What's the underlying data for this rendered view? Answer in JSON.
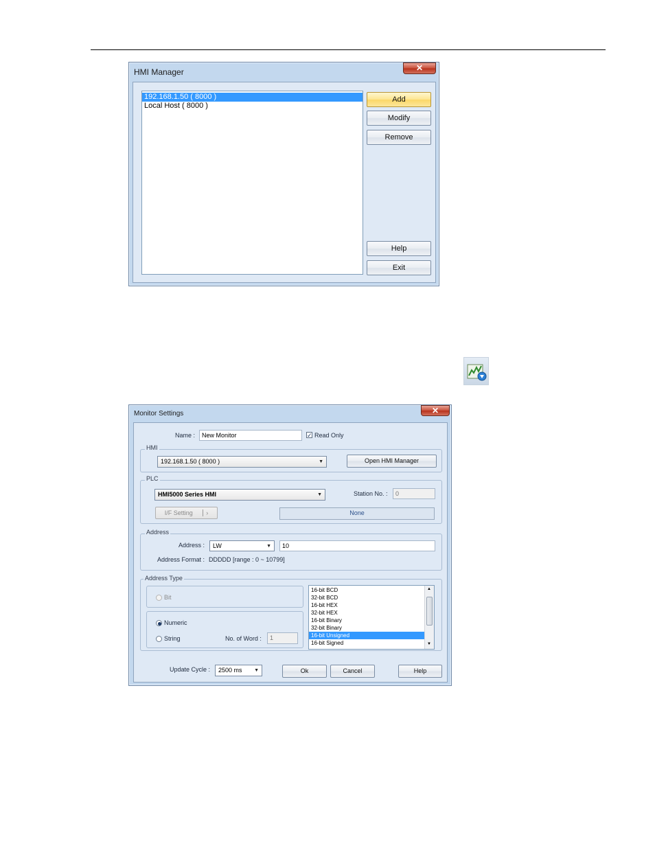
{
  "hmi_manager": {
    "title": "HMI Manager",
    "close_glyph": "✕",
    "entries": [
      {
        "label": "192.168.1.50 ( 8000 )",
        "selected": true
      },
      {
        "label": "Local Host ( 8000 )",
        "selected": false
      }
    ],
    "buttons": {
      "add": "Add",
      "modify": "Modify",
      "remove": "Remove",
      "help": "Help",
      "exit": "Exit"
    }
  },
  "toolbar_icon": {
    "icon": "add-monitor-chart-icon"
  },
  "monitor_settings": {
    "title": "Monitor Settings",
    "close_glyph": "✕",
    "name_label": "Name :",
    "name_value": "New Monitor",
    "read_only_label": "Read Only",
    "read_only_checked": true,
    "hmi": {
      "group_label": "HMI",
      "selected": "192.168.1.50 ( 8000 )",
      "open_manager_label": "Open HMI Manager"
    },
    "plc": {
      "group_label": "PLC",
      "selected": "HMI5000 Series HMI",
      "station_label": "Station No. :",
      "station_value": "0",
      "if_setting_label": "I/F Setting",
      "if_value": "None"
    },
    "address": {
      "group_label": "Address",
      "address_label": "Address :",
      "device": "LW",
      "value": "10",
      "format_label": "Address Format :",
      "format_value": "DDDDD [range : 0 ~ 10799]"
    },
    "address_type": {
      "group_label": "Address Type",
      "bit_label": "Bit",
      "numeric_label": "Numeric",
      "string_label": "String",
      "selected_type": "Numeric",
      "word_count_label": "No. of Word :",
      "word_count_value": "1",
      "formats": [
        {
          "label": "16-bit BCD",
          "selected": false
        },
        {
          "label": "32-bit BCD",
          "selected": false
        },
        {
          "label": "16-bit HEX",
          "selected": false
        },
        {
          "label": "32-bit HEX",
          "selected": false
        },
        {
          "label": "16-bit Binary",
          "selected": false
        },
        {
          "label": "32-bit Binary",
          "selected": false
        },
        {
          "label": "16-bit Unsigned",
          "selected": true
        },
        {
          "label": "16-bit Signed",
          "selected": false
        }
      ]
    },
    "update_cycle_label": "Update Cycle :",
    "update_cycle_value": "2500 ms",
    "buttons": {
      "ok": "Ok",
      "cancel": "Cancel",
      "help": "Help"
    }
  },
  "colors": {
    "selection": "#3399ff",
    "window_frame": "#c3d8ee",
    "client": "#dfe9f5",
    "close": "#c9533e"
  }
}
